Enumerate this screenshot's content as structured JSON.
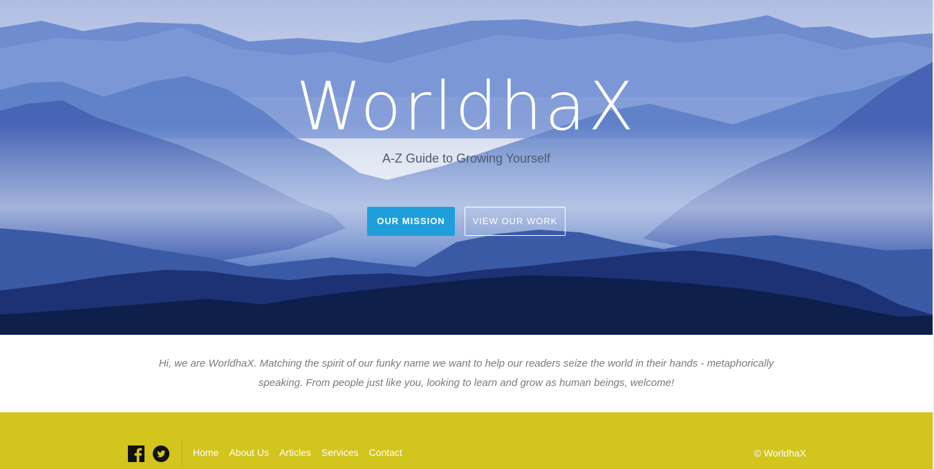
{
  "hero": {
    "title": "WorldhaX",
    "tagline": "A-Z Guide to Growing Yourself",
    "primary_button": "OUR MISSION",
    "secondary_button": "VIEW OUR WORK"
  },
  "intro": {
    "text": "Hi, we are WorldhaX. Matching the spirit of our funky name we want to help our readers seize the world in their hands - metaphorically speaking. From people just like you, looking to learn and grow as human beings, welcome!"
  },
  "footer": {
    "social": [
      "facebook-icon",
      "twitter-icon"
    ],
    "nav": [
      {
        "label": "Home"
      },
      {
        "label": "About Us"
      },
      {
        "label": "Articles"
      },
      {
        "label": "Services"
      },
      {
        "label": "Contact"
      }
    ],
    "copyright": "© WorldhaX"
  },
  "colors": {
    "primary_button": "#1e9fdb",
    "footer_bg": "#d3c41e",
    "sky": "#b9c8e6",
    "mountain_dark": "#0d1f4a"
  }
}
